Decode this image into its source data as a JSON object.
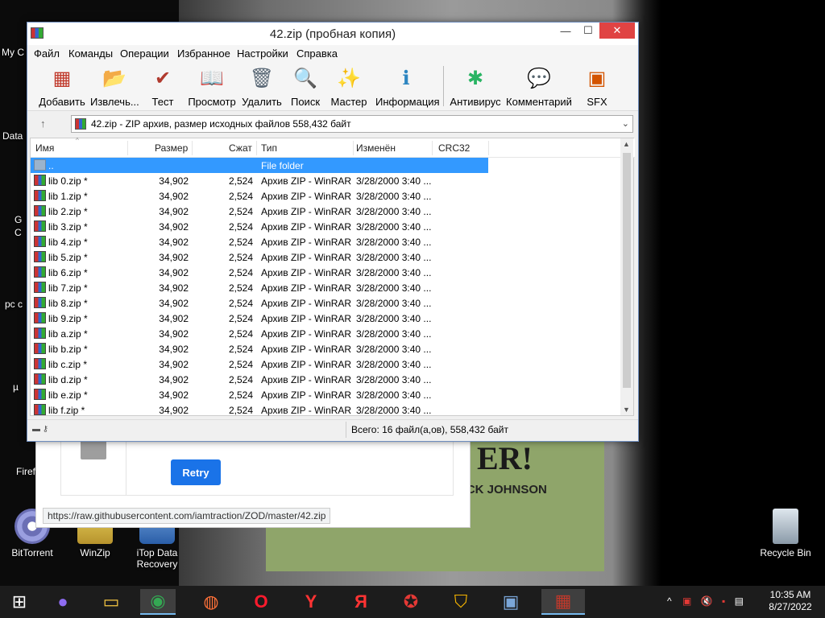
{
  "desktop": {
    "icons": [
      {
        "label": "BitTorrent",
        "icon": "bittorrent-icon"
      },
      {
        "label": "WinZip",
        "icon": "winzip-icon"
      },
      {
        "label": "iTop Data Recovery",
        "icon": "itop-icon"
      },
      {
        "label": "Recycle Bin",
        "icon": "recycle-bin-icon"
      }
    ],
    "partial_labels": [
      "My C",
      "Data",
      "G",
      "C",
      "pc c",
      "µ",
      "Firef"
    ]
  },
  "browser_bg": {
    "retry_label": "Retry",
    "status_url": "https://raw.githubusercontent.com/iamtraction/ZOD/master/42.zip"
  },
  "book_bg": {
    "title_fragment": "ER!",
    "author_fragment": "ACK JOHNSON"
  },
  "winrar": {
    "title": "42.zip (пробная копия)",
    "controls": {
      "minimize": "—",
      "maximize": "☐",
      "close": "✕"
    },
    "menu": [
      "Файл",
      "Команды",
      "Операции",
      "Избранное",
      "Настройки",
      "Справка"
    ],
    "toolbar": [
      {
        "label": "Добавить",
        "icon": "add-archive-icon",
        "glyph": "▦",
        "color": "#c0392b"
      },
      {
        "label": "Извлечь...",
        "icon": "extract-folder-icon",
        "glyph": "📂",
        "color": "#2e86de"
      },
      {
        "label": "Тест",
        "icon": "test-clipboard-icon",
        "glyph": "✔",
        "color": "#b03a2e"
      },
      {
        "label": "Просмотр",
        "icon": "view-book-icon",
        "glyph": "📖",
        "color": "#1e8449"
      },
      {
        "label": "Удалить",
        "icon": "delete-trash-icon",
        "glyph": "🗑",
        "color": "#566573"
      },
      {
        "label": "Поиск",
        "icon": "find-magnifier-icon",
        "glyph": "🔍",
        "color": "#2874a6"
      },
      {
        "label": "Мастер",
        "icon": "wizard-wand-icon",
        "glyph": "✨",
        "color": "#7d3c98"
      },
      {
        "label": "Информация",
        "icon": "info-icon",
        "glyph": "ℹ",
        "color": "#2e86c1"
      },
      {
        "label": "Антивирус",
        "icon": "antivirus-icon",
        "glyph": "✱",
        "color": "#28b463"
      },
      {
        "label": "Комментарий",
        "icon": "comment-icon",
        "glyph": "💬",
        "color": "#5d6d7e"
      },
      {
        "label": "SFX",
        "icon": "sfx-box-icon",
        "glyph": "▣",
        "color": "#d35400"
      }
    ],
    "address": "42.zip - ZIP архив, размер исходных файлов 558,432 байт",
    "columns": [
      "Имя",
      "Размер",
      "Сжат",
      "Тип",
      "Изменён",
      "CRC32"
    ],
    "rows": [
      {
        "name": "..",
        "size": "",
        "packed": "",
        "type": "File folder",
        "modified": "",
        "folder": true
      },
      {
        "name": "lib 0.zip *",
        "size": "34,902",
        "packed": "2,524",
        "type": "Архив ZIP - WinRAR",
        "modified": "3/28/2000 3:40 ..."
      },
      {
        "name": "lib 1.zip *",
        "size": "34,902",
        "packed": "2,524",
        "type": "Архив ZIP - WinRAR",
        "modified": "3/28/2000 3:40 ..."
      },
      {
        "name": "lib 2.zip *",
        "size": "34,902",
        "packed": "2,524",
        "type": "Архив ZIP - WinRAR",
        "modified": "3/28/2000 3:40 ..."
      },
      {
        "name": "lib 3.zip *",
        "size": "34,902",
        "packed": "2,524",
        "type": "Архив ZIP - WinRAR",
        "modified": "3/28/2000 3:40 ..."
      },
      {
        "name": "lib 4.zip *",
        "size": "34,902",
        "packed": "2,524",
        "type": "Архив ZIP - WinRAR",
        "modified": "3/28/2000 3:40 ..."
      },
      {
        "name": "lib 5.zip *",
        "size": "34,902",
        "packed": "2,524",
        "type": "Архив ZIP - WinRAR",
        "modified": "3/28/2000 3:40 ..."
      },
      {
        "name": "lib 6.zip *",
        "size": "34,902",
        "packed": "2,524",
        "type": "Архив ZIP - WinRAR",
        "modified": "3/28/2000 3:40 ..."
      },
      {
        "name": "lib 7.zip *",
        "size": "34,902",
        "packed": "2,524",
        "type": "Архив ZIP - WinRAR",
        "modified": "3/28/2000 3:40 ..."
      },
      {
        "name": "lib 8.zip *",
        "size": "34,902",
        "packed": "2,524",
        "type": "Архив ZIP - WinRAR",
        "modified": "3/28/2000 3:40 ..."
      },
      {
        "name": "lib 9.zip *",
        "size": "34,902",
        "packed": "2,524",
        "type": "Архив ZIP - WinRAR",
        "modified": "3/28/2000 3:40 ..."
      },
      {
        "name": "lib a.zip *",
        "size": "34,902",
        "packed": "2,524",
        "type": "Архив ZIP - WinRAR",
        "modified": "3/28/2000 3:40 ..."
      },
      {
        "name": "lib b.zip *",
        "size": "34,902",
        "packed": "2,524",
        "type": "Архив ZIP - WinRAR",
        "modified": "3/28/2000 3:40 ..."
      },
      {
        "name": "lib c.zip *",
        "size": "34,902",
        "packed": "2,524",
        "type": "Архив ZIP - WinRAR",
        "modified": "3/28/2000 3:40 ..."
      },
      {
        "name": "lib d.zip *",
        "size": "34,902",
        "packed": "2,524",
        "type": "Архив ZIP - WinRAR",
        "modified": "3/28/2000 3:40 ..."
      },
      {
        "name": "lib e.zip *",
        "size": "34,902",
        "packed": "2,524",
        "type": "Архив ZIP - WinRAR",
        "modified": "3/28/2000 3:40 ..."
      },
      {
        "name": "lib f.zip *",
        "size": "34,902",
        "packed": "2,524",
        "type": "Архив ZIP - WinRAR",
        "modified": "3/28/2000 3:40 ..."
      }
    ],
    "status": "Всего: 16 файл(а,ов), 558,432 байт"
  },
  "taskbar": {
    "items": [
      {
        "name": "start",
        "icon": "windows-start-icon",
        "glyph": "⊞",
        "color": "#ffffff"
      },
      {
        "name": "alice",
        "icon": "alice-assistant-icon",
        "glyph": "●",
        "color": "#8e6cf1"
      },
      {
        "name": "file-explorer",
        "icon": "file-explorer-icon",
        "glyph": "▭",
        "color": "#f4c542"
      },
      {
        "name": "chrome",
        "icon": "chrome-icon",
        "glyph": "◉",
        "color": "#34a853",
        "active": true
      },
      {
        "name": "firefox",
        "icon": "firefox-icon",
        "glyph": "◍",
        "color": "#ff7139"
      },
      {
        "name": "opera",
        "icon": "opera-icon",
        "glyph": "O",
        "color": "#ff1b2d"
      },
      {
        "name": "yandex-browser",
        "icon": "yandex-browser-icon",
        "glyph": "Y",
        "color": "#ff3333"
      },
      {
        "name": "yandex",
        "icon": "yandex-icon",
        "glyph": "Я",
        "color": "#ff3333"
      },
      {
        "name": "app-red",
        "icon": "app-gear-icon",
        "glyph": "✪",
        "color": "#e53935"
      },
      {
        "name": "vpn",
        "icon": "shield-vpn-icon",
        "glyph": "⛉",
        "color": "#f5b400"
      },
      {
        "name": "itop",
        "icon": "itop-recovery-icon",
        "glyph": "▣",
        "color": "#7aa6d8"
      },
      {
        "name": "winrar",
        "icon": "winrar-icon",
        "glyph": "▦",
        "color": "#c0392b",
        "active": true
      }
    ],
    "tray": "^",
    "time": "10:35 AM",
    "date": "8/27/2022"
  }
}
